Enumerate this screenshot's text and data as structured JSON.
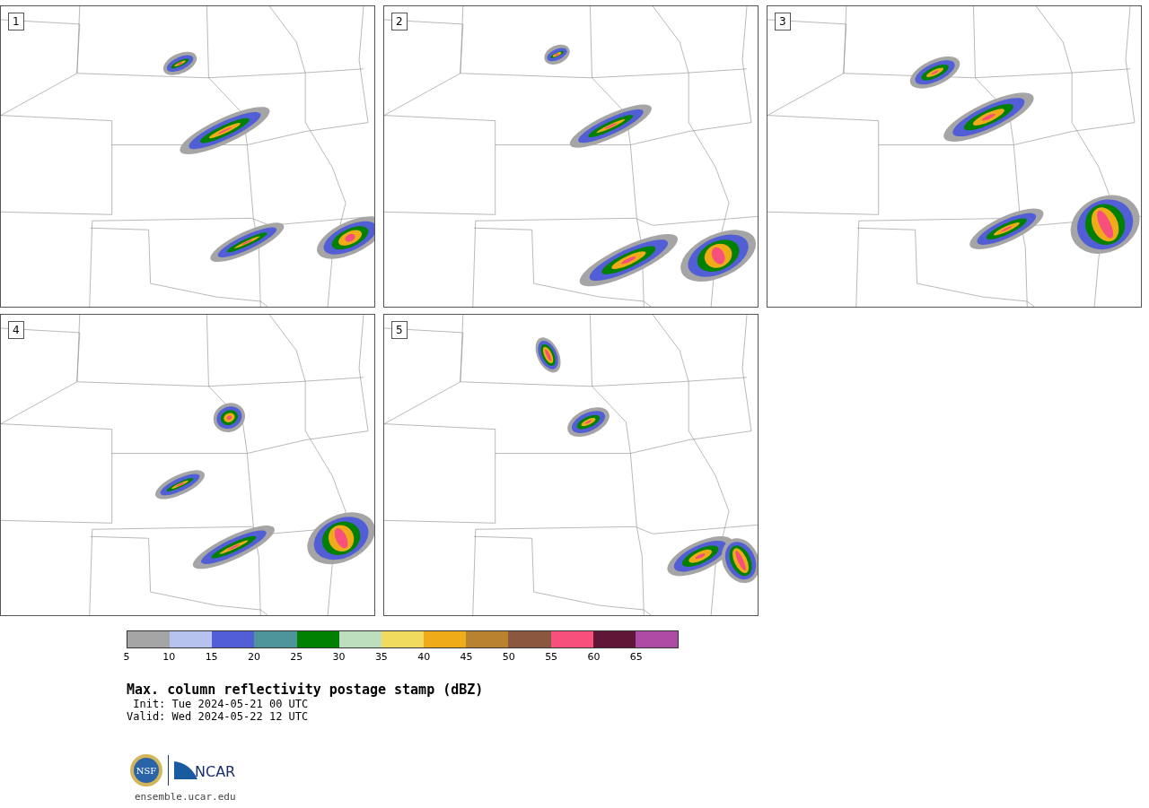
{
  "panels": [
    {
      "label": "1"
    },
    {
      "label": "2"
    },
    {
      "label": "3"
    },
    {
      "label": "4"
    },
    {
      "label": "5"
    }
  ],
  "colorbar": {
    "segments": [
      {
        "color": "#a5a5a5",
        "tick": "5"
      },
      {
        "color": "#b7c3ef",
        "tick": "10"
      },
      {
        "color": "#515ed6",
        "tick": "15"
      },
      {
        "color": "#4e959b",
        "tick": "20"
      },
      {
        "color": "#018101",
        "tick": "25"
      },
      {
        "color": "#bedfbe",
        "tick": "30"
      },
      {
        "color": "#f0db5f",
        "tick": "35"
      },
      {
        "color": "#f0ab18",
        "tick": "40"
      },
      {
        "color": "#b98230",
        "tick": "45"
      },
      {
        "color": "#89583e",
        "tick": "50"
      },
      {
        "color": "#f7507c",
        "tick": "55"
      },
      {
        "color": "#601636",
        "tick": "60"
      },
      {
        "color": "#ad4aa3",
        "tick": "65"
      }
    ]
  },
  "title": "Max. column reflectivity postage stamp (dBZ)",
  "init": " Init: Tue 2024-05-21 00 UTC",
  "valid": "Valid: Wed 2024-05-22 12 UTC",
  "logo": {
    "left": "NSF",
    "right": "NCAR"
  },
  "url": "ensemble.ucar.edu"
}
